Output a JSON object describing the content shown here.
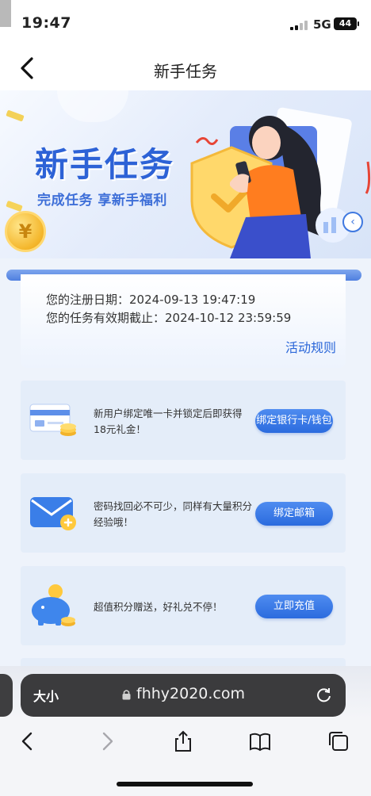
{
  "status_bar": {
    "time": "19:47",
    "network": "5G",
    "battery": "44"
  },
  "nav": {
    "title": "新手任务"
  },
  "banner": {
    "headline": "新手任务",
    "subtitle": "完成任务 享新手福利",
    "coin_symbol": "¥"
  },
  "info": {
    "register_line": "您的注册日期：2024-09-13 19:47:19",
    "expiry_line": "您的任务有效期截止：2024-10-12 23:59:59",
    "rules_link": "活动规则"
  },
  "tasks": [
    {
      "desc_line1": "新用户绑定唯一卡并锁定后即获得",
      "desc_line2": "18元礼金！",
      "button": "绑定银行卡/钱包",
      "icon": "bank-card-icon"
    },
    {
      "desc_line1": "密码找回必不可少，同样有大量积分",
      "desc_line2": "经验哦！",
      "button": "绑定邮箱",
      "icon": "envelope-icon"
    },
    {
      "desc_line1": "超值积分赠送，好礼兑不停！",
      "desc_line2": "",
      "button": "立即充值",
      "icon": "piggy-bank-icon"
    }
  ],
  "browser": {
    "text_size": "大小",
    "url": "fhhy2020.com"
  },
  "colors": {
    "accent": "#2b6bde",
    "headline": "#2d62d6",
    "card_bg": "#e4edf9"
  }
}
